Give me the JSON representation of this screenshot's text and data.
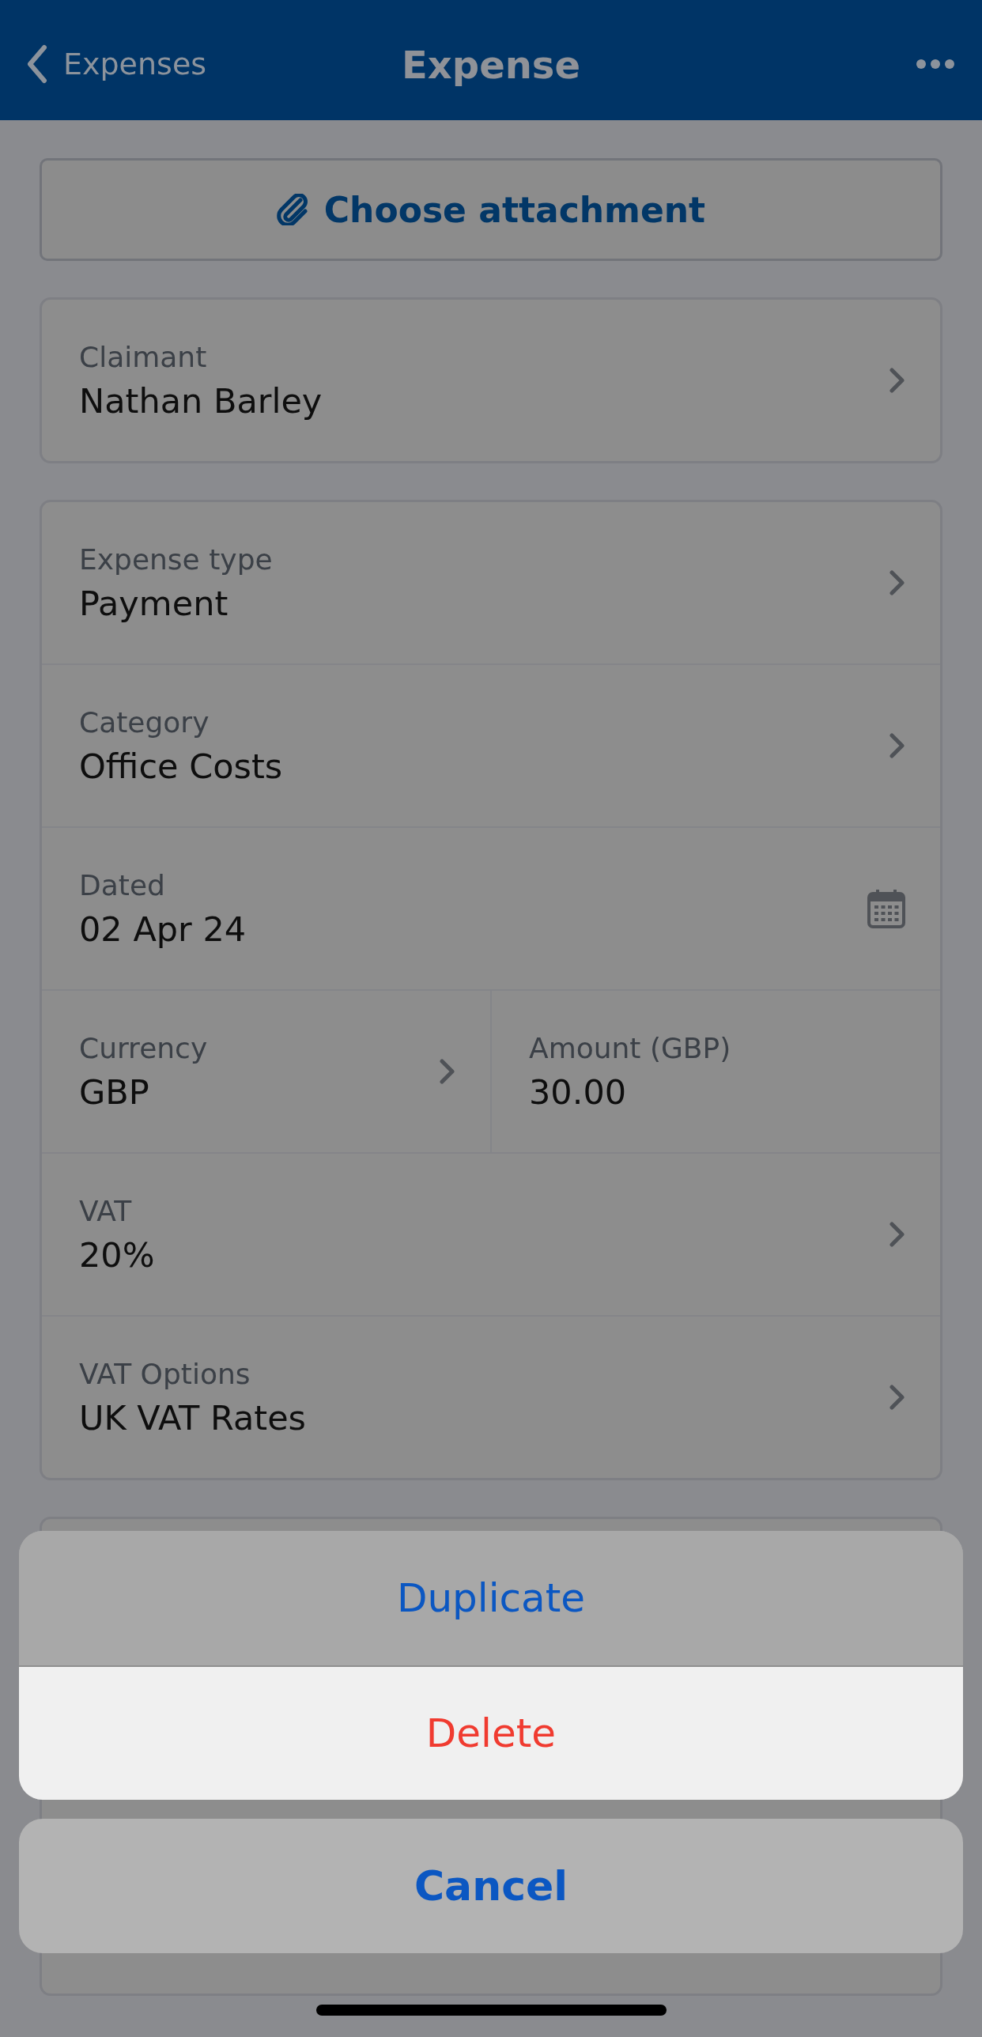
{
  "header": {
    "back_label": "Expenses",
    "title": "Expense"
  },
  "attachment_button": {
    "label": "Choose attachment"
  },
  "cards": [
    {
      "rows": [
        {
          "kind": "select",
          "label": "Claimant",
          "value": "Nathan Barley"
        }
      ]
    },
    {
      "rows": [
        {
          "kind": "select",
          "label": "Expense type",
          "value": "Payment"
        },
        {
          "kind": "select",
          "label": "Category",
          "value": "Office Costs"
        },
        {
          "kind": "date",
          "label": "Dated",
          "value": "02 Apr 24"
        },
        {
          "kind": "pair",
          "cells": [
            {
              "kind": "select",
              "label": "Currency",
              "value": "GBP"
            },
            {
              "kind": "input",
              "label": "Amount (GBP)",
              "value": "30.00"
            }
          ]
        },
        {
          "kind": "select",
          "label": "VAT",
          "value": "20%"
        },
        {
          "kind": "select",
          "label": "VAT Options",
          "value": "UK VAT Rates"
        }
      ]
    }
  ],
  "action_sheet": {
    "actions": [
      {
        "label": "Duplicate",
        "kind": "default",
        "selected": false
      },
      {
        "label": "Delete",
        "kind": "destructive",
        "selected": true
      }
    ],
    "cancel": {
      "label": "Cancel"
    }
  }
}
